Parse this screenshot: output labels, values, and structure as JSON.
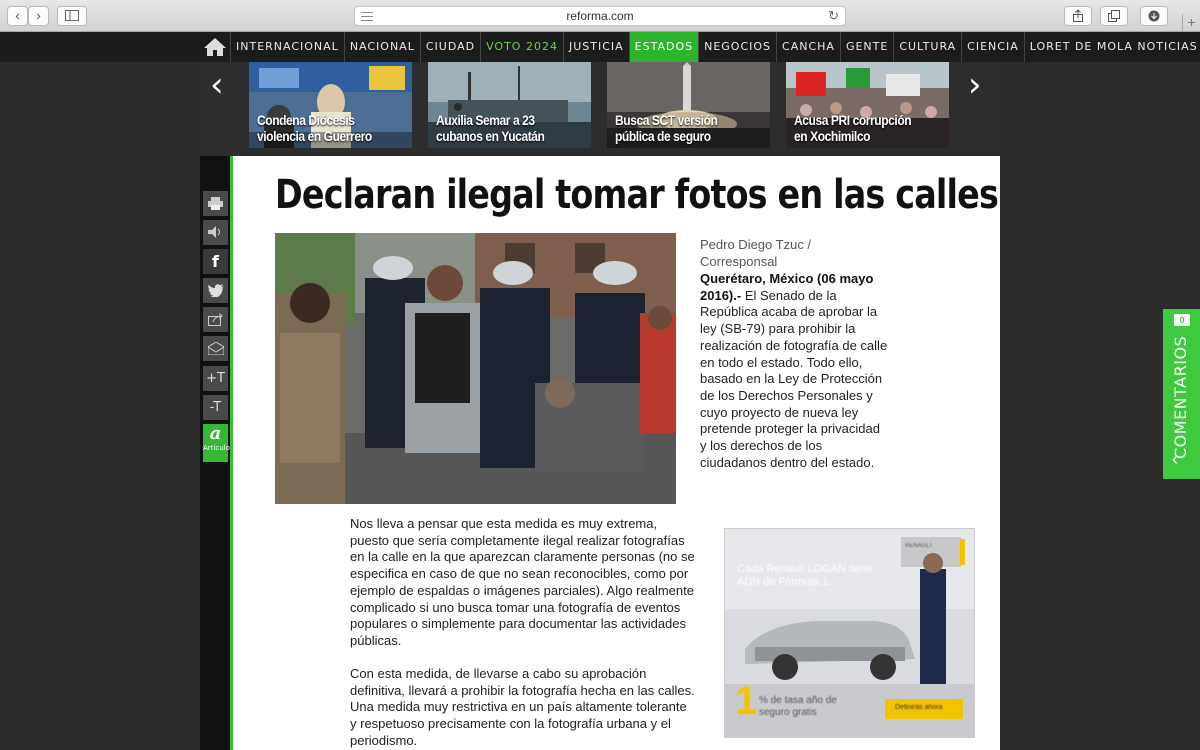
{
  "browser": {
    "url": "reforma.com",
    "back_icon": "‹",
    "forward_icon": "›",
    "reload_icon": "↻",
    "plus_icon": "+"
  },
  "nav": {
    "items": [
      {
        "label": "INTERNACIONAL"
      },
      {
        "label": "NACIONAL"
      },
      {
        "label": "CIUDAD"
      },
      {
        "label": "VOTO 2024"
      },
      {
        "label": "JUSTICIA"
      },
      {
        "label": "ESTADOS"
      },
      {
        "label": "NEGOCIOS"
      },
      {
        "label": "CANCHA"
      },
      {
        "label": "GENTE"
      },
      {
        "label": "CULTURA"
      },
      {
        "label": "CIENCIA"
      },
      {
        "label": "LORET DE MOLA NOTICIAS"
      }
    ],
    "active_item": "ESTADOS",
    "highlight_item": "VOTO 2024"
  },
  "carousel": {
    "prev": "‹",
    "next": "›",
    "cards": [
      {
        "caption": "Condena Diócesis violencia en Guerrero"
      },
      {
        "caption": "Auxilia Semar a 23 cubanos en Yucatán"
      },
      {
        "caption": "Busca SCT versión pública de seguro"
      },
      {
        "caption": "Acusa PRI corrupción en Xochimilco"
      }
    ]
  },
  "sidebar_tools": {
    "facebook": "f",
    "font_up": "+T",
    "font_down": "-T",
    "articulo_icon": "a",
    "articulo_label": "Artículo"
  },
  "article": {
    "headline": "Declaran ilegal tomar fotos en las calles",
    "byline": "Pedro Diego Tzuc / Corresponsal",
    "dateline": "Querétaro, México (06 mayo 2016).-",
    "lede": " El Senado  de la República acaba de aprobar la ley (SB-79) para prohibir la realización de fotografía de calle en todo el estado. Todo ello, basado en la Ley de Protección de los Derechos Personales y cuyo proyecto de nueva ley pretende proteger la privacidad y los derechos de los ciudadanos dentro del estado.",
    "paragraphs": [
      "Nos lleva a pensar que esta medida es muy extrema, puesto que sería completamente ilegal realizar fotografías en la calle en la que aparezcan claramente personas (no se especifica en caso de que no sean reconocibles, como por ejemplo de espaldas o imágenes parciales). Algo realmente complicado si uno busca tomar una fotografía de eventos populares o simplemente para documentar las actividades públicas.",
      "Con esta medida, de llevarse a cabo su aprobación definitiva, llevará a prohibir la fotografía hecha en las calles. Una medida muy restrictiva en un país altamente tolerante y respetuoso precisamente con la fotografía urbana y el periodismo."
    ]
  },
  "ad": {
    "headline": "Cada Renault LOGAN tiene ADN de Fórmula 1.",
    "brand": "RENAULT",
    "promo_number": "1",
    "promo_text": "% de tasa año de seguro gratis",
    "cta": "Definirás ahora"
  },
  "comments": {
    "label": "COMENTARIOS",
    "count": "0",
    "chevron": "‹"
  },
  "colors": {
    "accent_green": "#2db42d",
    "nav_bg": "#1c1c1c"
  }
}
